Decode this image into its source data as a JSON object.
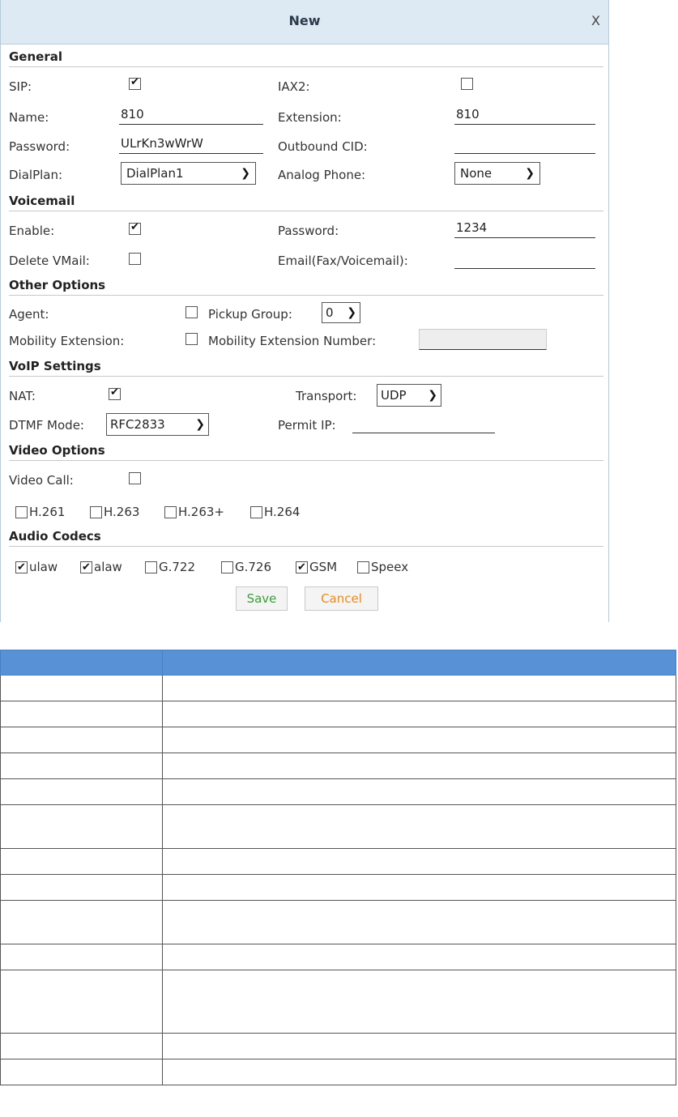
{
  "dialog": {
    "title": "New",
    "close": "X",
    "sections": {
      "general": "General",
      "voicemail": "Voicemail",
      "other": "Other Options",
      "voip": "VoIP Settings",
      "video": "Video Options",
      "audio": "Audio Codecs"
    },
    "general": {
      "sip_label": "SIP:",
      "sip_checked": true,
      "iax2_label": "IAX2:",
      "iax2_checked": false,
      "name_label": "Name:",
      "name_value": "810",
      "extension_label": "Extension:",
      "extension_value": "810",
      "password_label": "Password:",
      "password_value": "ULrKn3wWrW",
      "outbound_cid_label": "Outbound CID:",
      "outbound_cid_value": "",
      "dialplan_label": "DialPlan:",
      "dialplan_value": "DialPlan1",
      "analog_label": "Analog Phone:",
      "analog_value": "None"
    },
    "voicemail": {
      "enable_label": "Enable:",
      "enable_checked": true,
      "password_label": "Password:",
      "password_value": "1234",
      "delete_label": "Delete VMail:",
      "delete_checked": false,
      "email_label": "Email(Fax/Voicemail):",
      "email_value": ""
    },
    "other": {
      "agent_label": "Agent:",
      "agent_checked": false,
      "pickup_label": "Pickup Group:",
      "pickup_value": "0",
      "mobility_label": "Mobility Extension:",
      "mobility_checked": false,
      "mobility_number_label": "Mobility Extension Number:",
      "mobility_number_value": ""
    },
    "voip": {
      "nat_label": "NAT:",
      "nat_checked": true,
      "transport_label": "Transport:",
      "transport_value": "UDP",
      "dtmf_label": "DTMF Mode:",
      "dtmf_value": "RFC2833",
      "permit_label": "Permit IP:",
      "permit_value": ""
    },
    "video": {
      "video_call_label": "Video Call:",
      "video_call_checked": false,
      "codecs": [
        {
          "label": "H.261",
          "checked": false
        },
        {
          "label": "H.263",
          "checked": false
        },
        {
          "label": "H.263+",
          "checked": false
        },
        {
          "label": "H.264",
          "checked": false
        }
      ]
    },
    "audio": {
      "codecs": [
        {
          "label": "ulaw",
          "checked": true
        },
        {
          "label": "alaw",
          "checked": true
        },
        {
          "label": "G.722",
          "checked": false
        },
        {
          "label": "G.726",
          "checked": false
        },
        {
          "label": "GSM",
          "checked": true
        },
        {
          "label": "Speex",
          "checked": false
        }
      ]
    },
    "buttons": {
      "save": "Save",
      "cancel": "Cancel"
    }
  },
  "reference_table": {
    "header": [
      "",
      ""
    ],
    "rows": [
      {
        "col1": "",
        "col2": ""
      },
      {
        "col1": "",
        "col2": ""
      },
      {
        "col1": "",
        "col2": ""
      },
      {
        "col1": "",
        "col2": ""
      },
      {
        "col1": "",
        "col2": ""
      },
      {
        "col1": "",
        "col2": ""
      },
      {
        "col1": "",
        "col2": ""
      },
      {
        "col1": "",
        "col2": ""
      },
      {
        "col1": "",
        "col2": ""
      },
      {
        "col1": "",
        "col2": ""
      },
      {
        "col1": "",
        "col2": ""
      },
      {
        "col1": "",
        "col2": ""
      },
      {
        "col1": "",
        "col2": ""
      }
    ]
  }
}
